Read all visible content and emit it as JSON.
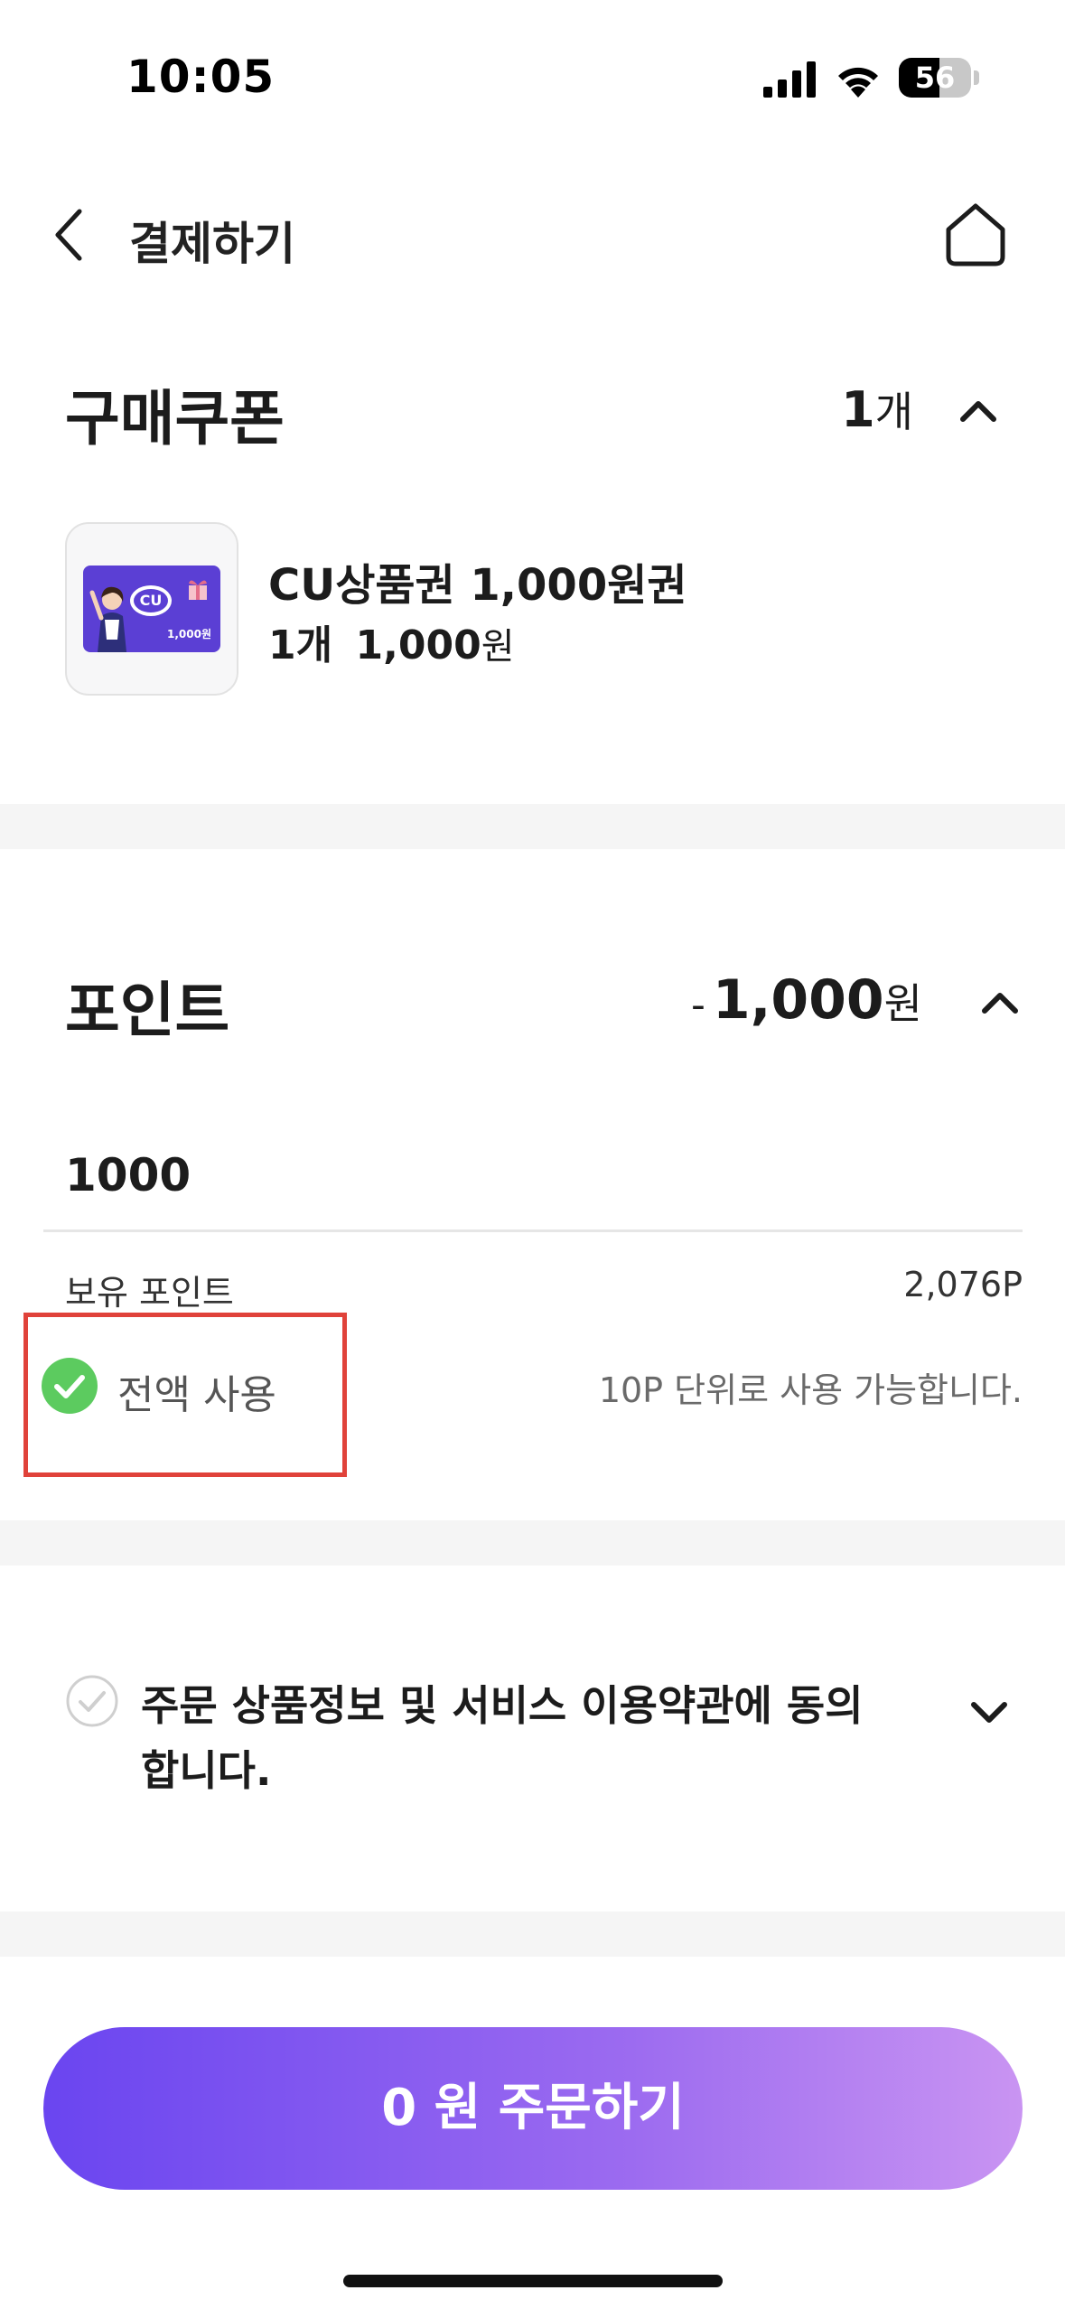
{
  "status_bar": {
    "time": "10:05",
    "battery": "56",
    "battery_level": 0.56,
    "icons": [
      "signal-icon",
      "wifi-icon",
      "battery-icon"
    ]
  },
  "header": {
    "title": "결제하기",
    "back_icon": "chevron-left-icon",
    "home_icon": "home-icon"
  },
  "coupon": {
    "title": "구매쿠폰",
    "count": "1",
    "count_unit": "개",
    "product": {
      "name": "CU상품권 1,000원권",
      "qty": "1개",
      "price": "1,000",
      "price_unit": "원",
      "thumb_logo": "CU",
      "thumb_amount": "1,000원"
    }
  },
  "point": {
    "title": "포인트",
    "discount_sign": "-",
    "discount": "1,000",
    "discount_unit": "원",
    "input_value": "1000",
    "held_label": "보유 포인트",
    "held_value": "2,076P",
    "use_all_label": "전액 사용",
    "use_all_checked": true,
    "unit_notice": "10P 단위로 사용 가능합니다."
  },
  "agreement": {
    "text": "주문 상품정보 및 서비스 이용약관에 동의합니다.",
    "checked": false
  },
  "order_button": {
    "label": "0 원 주문하기"
  },
  "colors": {
    "accent_gradient_start": "#6a45f0",
    "accent_gradient_end": "#c994f2",
    "check_green": "#5ccb5f",
    "highlight_red": "#e0423a",
    "divider_gray": "#f5f5f5"
  }
}
